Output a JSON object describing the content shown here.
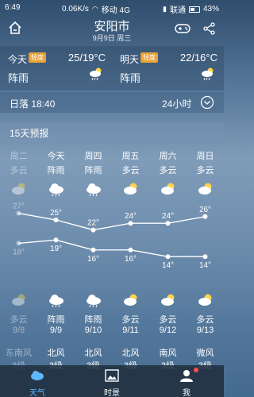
{
  "status_bar": {
    "time": "6:49",
    "speed": "0.06K/s",
    "carrier1": "移动 4G",
    "carrier2": "联通",
    "battery": "43%"
  },
  "header": {
    "city": "安阳市",
    "date": "9月9日 周三"
  },
  "today": {
    "label": "今天",
    "badge": "轻度",
    "temp": "25/19°C",
    "desc": "阵雨",
    "icon": "rain-cloud-icon"
  },
  "tomorrow": {
    "label": "明天",
    "badge": "轻度",
    "temp": "22/16°C",
    "desc": "阵雨",
    "icon": "rain-cloud-icon"
  },
  "sunset": {
    "text": "日落 18:40",
    "hours_label": "24小时"
  },
  "forecast": {
    "title": "15天预报",
    "days": [
      {
        "name": "周二",
        "cond_day": "多云",
        "cond_night": "多云",
        "date": "9/8",
        "wind": "东南风",
        "level": "3级",
        "high": "27°",
        "low": "18°",
        "past": true
      },
      {
        "name": "今天",
        "cond_day": "阵雨",
        "cond_night": "阵雨",
        "date": "9/9",
        "wind": "北风",
        "level": "3级",
        "high": "25°",
        "low": "19°",
        "past": false
      },
      {
        "name": "周四",
        "cond_day": "阵雨",
        "cond_night": "阵雨",
        "date": "9/10",
        "wind": "北风",
        "level": "3级",
        "high": "22°",
        "low": "16°",
        "past": false
      },
      {
        "name": "周五",
        "cond_day": "多云",
        "cond_night": "多云",
        "date": "9/11",
        "wind": "北风",
        "level": "3级",
        "high": "24°",
        "low": "16°",
        "past": false
      },
      {
        "name": "周六",
        "cond_day": "多云",
        "cond_night": "多云",
        "date": "9/12",
        "wind": "南风",
        "level": "3级",
        "high": "24°",
        "low": "14°",
        "past": false
      },
      {
        "name": "周日",
        "cond_day": "多云",
        "cond_night": "多云",
        "date": "9/13",
        "wind": "微风",
        "level": "3级",
        "high": "26°",
        "low": "14°",
        "past": false
      }
    ]
  },
  "temps": {
    "highs": [
      27,
      25,
      22,
      24,
      24,
      26
    ],
    "lows": [
      18,
      19,
      16,
      16,
      14,
      14
    ]
  },
  "nav": {
    "weather": "天气",
    "moments": "时景",
    "me": "我"
  },
  "colors": {
    "accent": "#5fb8ff",
    "badge": "#e8a238",
    "notify": "#ff4d4d"
  }
}
